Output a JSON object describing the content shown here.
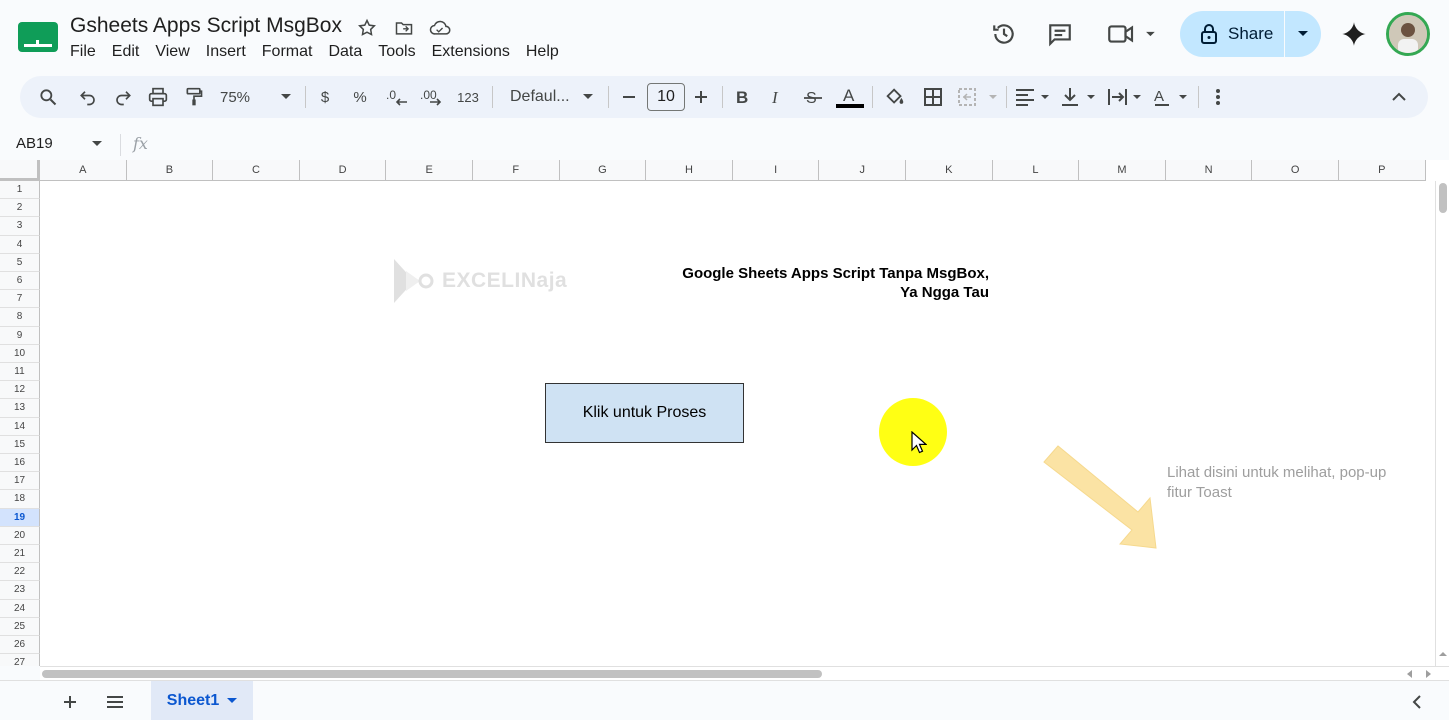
{
  "document": {
    "title": "Gsheets Apps Script MsgBox"
  },
  "menu": [
    "File",
    "Edit",
    "View",
    "Insert",
    "Format",
    "Data",
    "Tools",
    "Extensions",
    "Help"
  ],
  "share": {
    "label": "Share"
  },
  "toolbar": {
    "zoom": "75%",
    "currency": "$",
    "percent": "%",
    "number_format": "123",
    "font": "Defaul...",
    "font_size": "10"
  },
  "formula_bar": {
    "cell_ref": "AB19",
    "fx": "fx"
  },
  "columns": [
    "A",
    "B",
    "C",
    "D",
    "E",
    "F",
    "G",
    "H",
    "I",
    "J",
    "K",
    "L",
    "M",
    "N",
    "O",
    "P"
  ],
  "rows": [
    "1",
    "2",
    "3",
    "4",
    "5",
    "6",
    "7",
    "8",
    "9",
    "10",
    "11",
    "12",
    "13",
    "14",
    "15",
    "16",
    "17",
    "18",
    "19",
    "20",
    "21",
    "22",
    "23",
    "24",
    "25",
    "26",
    "27"
  ],
  "selected_row": "19",
  "sheet": {
    "watermark": "EXCELINaja",
    "heading_line1": "Google Sheets Apps Script Tanpa MsgBox,",
    "heading_line2": "Ya Ngga Tau",
    "button_label": "Klik untuk Proses",
    "hint_line1": "Lihat disini untuk melihat, pop-up",
    "hint_line2": "fitur Toast"
  },
  "tabs": [
    {
      "label": "Sheet1"
    }
  ],
  "colors": {
    "share_bg": "#c2e7ff",
    "button_bg": "#cfe2f3",
    "cursor_halo": "#ffff00",
    "arrow": "#fbe3a4",
    "active_tab": "#e1e9f7"
  }
}
